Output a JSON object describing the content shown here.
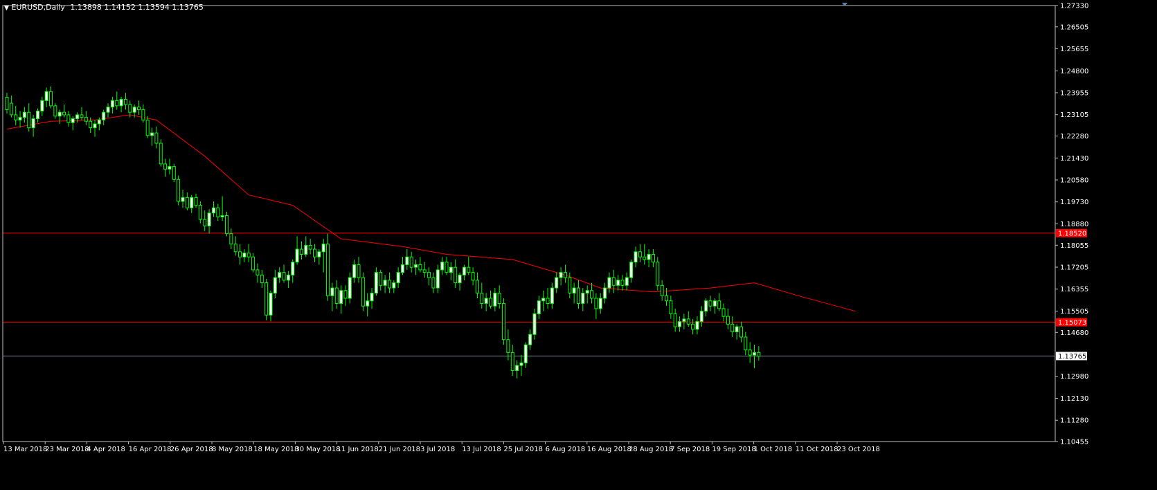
{
  "header": {
    "symbol": "EURUSD,Daily",
    "quote": "1.13898 1.14152 1.13594 1.13765"
  },
  "colors": {
    "background": "#000000",
    "frame": "#c0c0c0",
    "axis_text": "#ffffff",
    "bull_candle_fill": "#ffffff",
    "bear_candle_fill": "#000000",
    "candle_wick": "#00ff00",
    "moving_average": "#ff0000",
    "hline": "#ff0000",
    "bid_line": "#778899",
    "price_tag": "#ff0000"
  },
  "chart_data": {
    "type": "candlestick",
    "title": "EURUSD,Daily",
    "ylim": [
      1.10455,
      1.2733
    ],
    "y_ticks": [
      "1.27330",
      "1.26505",
      "1.25655",
      "1.24800",
      "1.23955",
      "1.23105",
      "1.22280",
      "1.21430",
      "1.20580",
      "1.19730",
      "1.18880",
      "1.18055",
      "1.17205",
      "1.16355",
      "1.15505",
      "1.14680",
      "1.12980",
      "1.12130",
      "1.11280",
      "1.10455"
    ],
    "x_ticks": [
      "13 Mar 2018",
      "23 Mar 2018",
      "4 Apr 2018",
      "16 Apr 2018",
      "26 Apr 2018",
      "8 May 2018",
      "18 May 2018",
      "30 May 2018",
      "11 Jun 2018",
      "21 Jun 2018",
      "3 Jul 2018",
      "13 Jul 2018",
      "25 Jul 2018",
      "6 Aug 2018",
      "16 Aug 2018",
      "28 Aug 2018",
      "7 Sep 2018",
      "19 Sep 2018",
      "1 Oct 2018",
      "11 Oct 2018",
      "23 Oct 2018"
    ],
    "horizontal_lines": [
      {
        "label": "1.18520",
        "value": 1.1852
      },
      {
        "label": "1.15073",
        "value": 1.15073
      }
    ],
    "bid_line": {
      "label": "1.13765",
      "value": 1.13765
    },
    "moving_average": [
      {
        "bar": 0,
        "value": 1.2255
      },
      {
        "bar": 10,
        "value": 1.2285
      },
      {
        "bar": 20,
        "value": 1.229
      },
      {
        "bar": 28,
        "value": 1.231
      },
      {
        "bar": 34,
        "value": 1.229
      },
      {
        "bar": 45,
        "value": 1.215
      },
      {
        "bar": 55,
        "value": 1.2
      },
      {
        "bar": 65,
        "value": 1.196
      },
      {
        "bar": 76,
        "value": 1.183
      },
      {
        "bar": 90,
        "value": 1.18
      },
      {
        "bar": 100,
        "value": 1.177
      },
      {
        "bar": 115,
        "value": 1.175
      },
      {
        "bar": 127,
        "value": 1.169
      },
      {
        "bar": 135,
        "value": 1.164
      },
      {
        "bar": 147,
        "value": 1.1625
      },
      {
        "bar": 160,
        "value": 1.164
      },
      {
        "bar": 170,
        "value": 1.166
      },
      {
        "bar": 180,
        "value": 1.161
      },
      {
        "bar": 193,
        "value": 1.155
      }
    ],
    "candles": [
      [
        1.2378,
        1.2395,
        1.2315,
        1.233
      ],
      [
        1.2355,
        1.2385,
        1.23,
        1.231
      ],
      [
        1.231,
        1.2345,
        1.227,
        1.229
      ],
      [
        1.229,
        1.2325,
        1.226,
        1.23
      ],
      [
        1.23,
        1.234,
        1.228,
        1.232
      ],
      [
        1.232,
        1.2355,
        1.2245,
        1.226
      ],
      [
        1.226,
        1.231,
        1.2225,
        1.2295
      ],
      [
        1.2295,
        1.2335,
        1.228,
        1.2325
      ],
      [
        1.2325,
        1.238,
        1.2305,
        1.2365
      ],
      [
        1.2365,
        1.2415,
        1.234,
        1.24
      ],
      [
        1.24,
        1.242,
        1.2335,
        1.2345
      ],
      [
        1.2345,
        1.2355,
        1.2295,
        1.2305
      ],
      [
        1.2305,
        1.233,
        1.2275,
        1.232
      ],
      [
        1.232,
        1.235,
        1.23,
        1.231
      ],
      [
        1.231,
        1.2325,
        1.2265,
        1.228
      ],
      [
        1.228,
        1.2305,
        1.225,
        1.2295
      ],
      [
        1.2295,
        1.232,
        1.228,
        1.231
      ],
      [
        1.231,
        1.234,
        1.229,
        1.23
      ],
      [
        1.23,
        1.2325,
        1.227,
        1.2285
      ],
      [
        1.2285,
        1.23,
        1.224,
        1.226
      ],
      [
        1.226,
        1.229,
        1.2225,
        1.2275
      ],
      [
        1.2275,
        1.23,
        1.225,
        1.229
      ],
      [
        1.229,
        1.233,
        1.227,
        1.232
      ],
      [
        1.232,
        1.2355,
        1.23,
        1.234
      ],
      [
        1.234,
        1.238,
        1.2315,
        1.2365
      ],
      [
        1.2365,
        1.24,
        1.233,
        1.2345
      ],
      [
        1.2345,
        1.238,
        1.232,
        1.237
      ],
      [
        1.237,
        1.2395,
        1.233,
        1.235
      ],
      [
        1.235,
        1.2365,
        1.23,
        1.232
      ],
      [
        1.232,
        1.235,
        1.23,
        1.234
      ],
      [
        1.234,
        1.2365,
        1.231,
        1.233
      ],
      [
        1.233,
        1.235,
        1.228,
        1.229
      ],
      [
        1.229,
        1.2305,
        1.222,
        1.223
      ],
      [
        1.223,
        1.226,
        1.219,
        1.224
      ],
      [
        1.224,
        1.2265,
        1.218,
        1.22
      ],
      [
        1.22,
        1.2215,
        1.211,
        1.212
      ],
      [
        1.212,
        1.214,
        1.207,
        1.21
      ],
      [
        1.21,
        1.214,
        1.208,
        1.211
      ],
      [
        1.211,
        1.212,
        1.205,
        1.206
      ],
      [
        1.206,
        1.2075,
        1.196,
        1.1975
      ],
      [
        1.1975,
        1.202,
        1.195,
        1.199
      ],
      [
        1.199,
        1.201,
        1.194,
        1.195
      ],
      [
        1.195,
        1.2,
        1.193,
        1.199
      ],
      [
        1.199,
        1.2005,
        1.195,
        1.196
      ],
      [
        1.196,
        1.1975,
        1.189,
        1.1905
      ],
      [
        1.1905,
        1.194,
        1.186,
        1.188
      ],
      [
        1.188,
        1.1945,
        1.185,
        1.193
      ],
      [
        1.193,
        1.1975,
        1.1915,
        1.195
      ],
      [
        1.195,
        1.1965,
        1.19,
        1.1915
      ],
      [
        1.1915,
        1.1995,
        1.19,
        1.192
      ],
      [
        1.192,
        1.1935,
        1.184,
        1.185
      ],
      [
        1.185,
        1.187,
        1.179,
        1.181
      ],
      [
        1.181,
        1.184,
        1.1765,
        1.178
      ],
      [
        1.178,
        1.181,
        1.173,
        1.176
      ],
      [
        1.176,
        1.179,
        1.174,
        1.1775
      ],
      [
        1.1775,
        1.181,
        1.174,
        1.176
      ],
      [
        1.176,
        1.1775,
        1.17,
        1.171
      ],
      [
        1.171,
        1.1735,
        1.166,
        1.169
      ],
      [
        1.169,
        1.171,
        1.164,
        1.166
      ],
      [
        1.166,
        1.1675,
        1.1515,
        1.1535
      ],
      [
        1.1535,
        1.163,
        1.151,
        1.162
      ],
      [
        1.162,
        1.171,
        1.16,
        1.168
      ],
      [
        1.168,
        1.172,
        1.166,
        1.17
      ],
      [
        1.17,
        1.173,
        1.166,
        1.167
      ],
      [
        1.167,
        1.1705,
        1.164,
        1.169
      ],
      [
        1.169,
        1.175,
        1.166,
        1.174
      ],
      [
        1.174,
        1.184,
        1.173,
        1.179
      ],
      [
        1.179,
        1.182,
        1.175,
        1.177
      ],
      [
        1.177,
        1.184,
        1.176,
        1.1805
      ],
      [
        1.1805,
        1.183,
        1.177,
        1.179
      ],
      [
        1.179,
        1.181,
        1.174,
        1.176
      ],
      [
        1.176,
        1.179,
        1.173,
        1.178
      ],
      [
        1.178,
        1.183,
        1.17,
        1.181
      ],
      [
        1.181,
        1.185,
        1.159,
        1.161
      ],
      [
        1.161,
        1.166,
        1.155,
        1.164
      ],
      [
        1.164,
        1.167,
        1.156,
        1.158
      ],
      [
        1.158,
        1.165,
        1.154,
        1.163
      ],
      [
        1.163,
        1.165,
        1.157,
        1.16
      ],
      [
        1.16,
        1.17,
        1.158,
        1.168
      ],
      [
        1.168,
        1.175,
        1.166,
        1.173
      ],
      [
        1.173,
        1.176,
        1.166,
        1.168
      ],
      [
        1.168,
        1.17,
        1.155,
        1.157
      ],
      [
        1.157,
        1.162,
        1.153,
        1.159
      ],
      [
        1.159,
        1.164,
        1.156,
        1.162
      ],
      [
        1.162,
        1.172,
        1.161,
        1.17
      ],
      [
        1.17,
        1.171,
        1.163,
        1.165
      ],
      [
        1.165,
        1.169,
        1.162,
        1.167
      ],
      [
        1.167,
        1.17,
        1.162,
        1.164
      ],
      [
        1.164,
        1.167,
        1.162,
        1.166
      ],
      [
        1.166,
        1.172,
        1.164,
        1.17
      ],
      [
        1.17,
        1.176,
        1.169,
        1.173
      ],
      [
        1.173,
        1.179,
        1.171,
        1.176
      ],
      [
        1.176,
        1.178,
        1.17,
        1.172
      ],
      [
        1.172,
        1.175,
        1.169,
        1.173
      ],
      [
        1.173,
        1.176,
        1.17,
        1.171
      ],
      [
        1.171,
        1.174,
        1.168,
        1.17
      ],
      [
        1.17,
        1.172,
        1.165,
        1.168
      ],
      [
        1.168,
        1.17,
        1.162,
        1.164
      ],
      [
        1.164,
        1.173,
        1.162,
        1.171
      ],
      [
        1.171,
        1.176,
        1.169,
        1.174
      ],
      [
        1.174,
        1.176,
        1.169,
        1.17
      ],
      [
        1.17,
        1.174,
        1.167,
        1.172
      ],
      [
        1.172,
        1.175,
        1.164,
        1.166
      ],
      [
        1.166,
        1.17,
        1.163,
        1.169
      ],
      [
        1.169,
        1.173,
        1.167,
        1.172
      ],
      [
        1.172,
        1.176,
        1.169,
        1.17
      ],
      [
        1.17,
        1.172,
        1.165,
        1.167
      ],
      [
        1.167,
        1.17,
        1.16,
        1.162
      ],
      [
        1.162,
        1.166,
        1.156,
        1.158
      ],
      [
        1.158,
        1.162,
        1.155,
        1.16
      ],
      [
        1.16,
        1.163,
        1.156,
        1.157
      ],
      [
        1.157,
        1.164,
        1.155,
        1.162
      ],
      [
        1.162,
        1.165,
        1.156,
        1.158
      ],
      [
        1.158,
        1.16,
        1.142,
        1.144
      ],
      [
        1.144,
        1.148,
        1.136,
        1.139
      ],
      [
        1.139,
        1.142,
        1.13,
        1.132
      ],
      [
        1.132,
        1.136,
        1.129,
        1.134
      ],
      [
        1.134,
        1.138,
        1.13,
        1.135
      ],
      [
        1.135,
        1.143,
        1.133,
        1.142
      ],
      [
        1.142,
        1.148,
        1.14,
        1.146
      ],
      [
        1.146,
        1.156,
        1.144,
        1.154
      ],
      [
        1.154,
        1.161,
        1.152,
        1.159
      ],
      [
        1.159,
        1.163,
        1.155,
        1.16
      ],
      [
        1.16,
        1.164,
        1.156,
        1.158
      ],
      [
        1.158,
        1.166,
        1.156,
        1.164
      ],
      [
        1.164,
        1.17,
        1.162,
        1.168
      ],
      [
        1.168,
        1.172,
        1.165,
        1.17
      ],
      [
        1.17,
        1.173,
        1.166,
        1.168
      ],
      [
        1.168,
        1.17,
        1.16,
        1.162
      ],
      [
        1.162,
        1.166,
        1.158,
        1.164
      ],
      [
        1.164,
        1.167,
        1.156,
        1.158
      ],
      [
        1.158,
        1.164,
        1.155,
        1.162
      ],
      [
        1.162,
        1.165,
        1.158,
        1.163
      ],
      [
        1.163,
        1.166,
        1.158,
        1.16
      ],
      [
        1.16,
        1.162,
        1.152,
        1.156
      ],
      [
        1.156,
        1.162,
        1.154,
        1.16
      ],
      [
        1.16,
        1.166,
        1.158,
        1.164
      ],
      [
        1.164,
        1.17,
        1.162,
        1.168
      ],
      [
        1.168,
        1.171,
        1.162,
        1.165
      ],
      [
        1.165,
        1.169,
        1.163,
        1.167
      ],
      [
        1.167,
        1.169,
        1.163,
        1.165
      ],
      [
        1.165,
        1.17,
        1.163,
        1.168
      ],
      [
        1.168,
        1.175,
        1.166,
        1.174
      ],
      [
        1.174,
        1.18,
        1.172,
        1.178
      ],
      [
        1.178,
        1.181,
        1.174,
        1.176
      ],
      [
        1.176,
        1.181,
        1.173,
        1.175
      ],
      [
        1.175,
        1.179,
        1.172,
        1.177
      ],
      [
        1.177,
        1.179,
        1.172,
        1.174
      ],
      [
        1.174,
        1.176,
        1.163,
        1.165
      ],
      [
        1.165,
        1.167,
        1.159,
        1.161
      ],
      [
        1.161,
        1.164,
        1.157,
        1.159
      ],
      [
        1.159,
        1.161,
        1.152,
        1.154
      ],
      [
        1.154,
        1.156,
        1.147,
        1.149
      ],
      [
        1.149,
        1.153,
        1.147,
        1.151
      ],
      [
        1.151,
        1.154,
        1.148,
        1.152
      ],
      [
        1.152,
        1.155,
        1.149,
        1.15
      ],
      [
        1.15,
        1.152,
        1.146,
        1.148
      ],
      [
        1.148,
        1.153,
        1.146,
        1.151
      ],
      [
        1.151,
        1.157,
        1.149,
        1.155
      ],
      [
        1.155,
        1.16,
        1.153,
        1.159
      ],
      [
        1.159,
        1.161,
        1.155,
        1.157
      ],
      [
        1.157,
        1.16,
        1.154,
        1.159
      ],
      [
        1.159,
        1.162,
        1.155,
        1.156
      ],
      [
        1.156,
        1.158,
        1.151,
        1.153
      ],
      [
        1.153,
        1.156,
        1.148,
        1.15
      ],
      [
        1.15,
        1.153,
        1.145,
        1.147
      ],
      [
        1.147,
        1.15,
        1.144,
        1.149
      ],
      [
        1.149,
        1.151,
        1.143,
        1.145
      ],
      [
        1.145,
        1.147,
        1.138,
        1.14
      ],
      [
        1.14,
        1.143,
        1.135,
        1.138
      ],
      [
        1.138,
        1.142,
        1.133,
        1.139
      ],
      [
        1.139,
        1.1415,
        1.1359,
        1.1376
      ]
    ]
  }
}
